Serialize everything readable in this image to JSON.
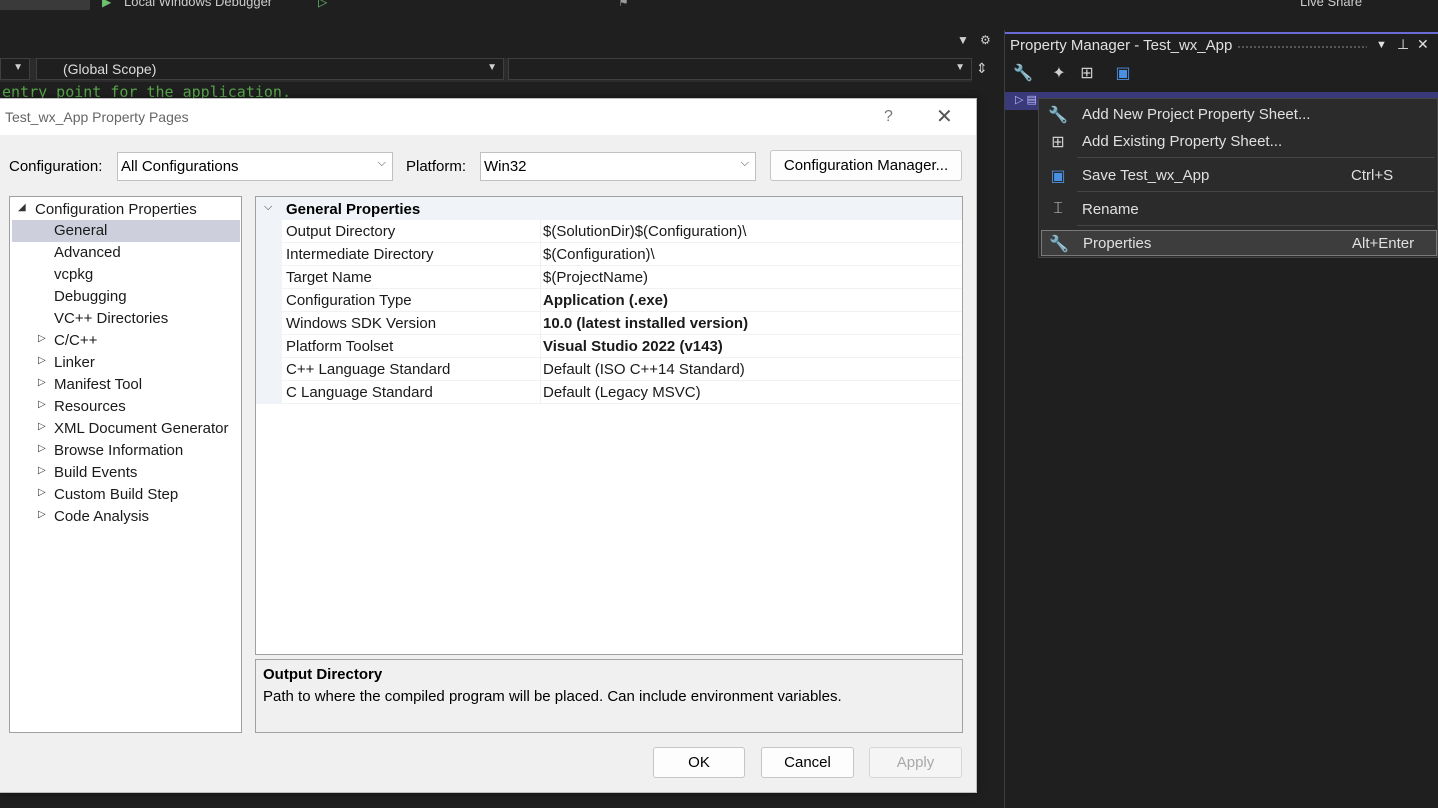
{
  "toolbar": {
    "run_label": "Local Windows Debugger",
    "live_share": "Live Share"
  },
  "editor": {
    "scope": "(Global Scope)",
    "code_line": "entry point for the application."
  },
  "property_manager": {
    "title": "Property Manager - Test_wx_App",
    "icons": [
      "wrench-icon",
      "wand-icon",
      "add-sheet-icon",
      "save-icon"
    ]
  },
  "context_menu": {
    "items": [
      {
        "label": "Add New Project Property Sheet...",
        "shortcut": "",
        "icon": "wrench-icon"
      },
      {
        "label": "Add Existing Property Sheet...",
        "shortcut": "",
        "icon": "add-sheet-icon"
      },
      {
        "label": "Save Test_wx_App",
        "shortcut": "Ctrl+S",
        "icon": "save-icon"
      },
      {
        "label": "Rename",
        "shortcut": "",
        "icon": "rename-icon"
      },
      {
        "label": "Properties",
        "shortcut": "Alt+Enter",
        "icon": "wrench-icon"
      }
    ]
  },
  "dialog": {
    "title": "Test_wx_App Property Pages",
    "help": "?",
    "configuration_label": "Configuration:",
    "configuration_value": "All Configurations",
    "platform_label": "Platform:",
    "platform_value": "Win32",
    "config_manager_button": "Configuration Manager...",
    "tree": {
      "root": "Configuration Properties",
      "items": [
        {
          "label": "General",
          "expandable": false,
          "selected": true
        },
        {
          "label": "Advanced",
          "expandable": false
        },
        {
          "label": "vcpkg",
          "expandable": false
        },
        {
          "label": "Debugging",
          "expandable": false
        },
        {
          "label": "VC++ Directories",
          "expandable": false
        },
        {
          "label": "C/C++",
          "expandable": true
        },
        {
          "label": "Linker",
          "expandable": true
        },
        {
          "label": "Manifest Tool",
          "expandable": true
        },
        {
          "label": "Resources",
          "expandable": true
        },
        {
          "label": "XML Document Generator",
          "expandable": true
        },
        {
          "label": "Browse Information",
          "expandable": true
        },
        {
          "label": "Build Events",
          "expandable": true
        },
        {
          "label": "Custom Build Step",
          "expandable": true
        },
        {
          "label": "Code Analysis",
          "expandable": true
        }
      ]
    },
    "grid": {
      "category": "General Properties",
      "rows": [
        {
          "name": "Output Directory",
          "value": "$(SolutionDir)$(Configuration)\\",
          "bold": false
        },
        {
          "name": "Intermediate Directory",
          "value": "$(Configuration)\\",
          "bold": false
        },
        {
          "name": "Target Name",
          "value": "$(ProjectName)",
          "bold": false
        },
        {
          "name": "Configuration Type",
          "value": "Application (.exe)",
          "bold": true
        },
        {
          "name": "Windows SDK Version",
          "value": "10.0 (latest installed version)",
          "bold": true
        },
        {
          "name": "Platform Toolset",
          "value": "Visual Studio 2022 (v143)",
          "bold": true
        },
        {
          "name": "C++ Language Standard",
          "value": "Default (ISO C++14 Standard)",
          "bold": false
        },
        {
          "name": "C Language Standard",
          "value": "Default (Legacy MSVC)",
          "bold": false
        }
      ]
    },
    "description": {
      "title": "Output Directory",
      "text": "Path to where the compiled program will be placed. Can include environment variables."
    },
    "buttons": {
      "ok": "OK",
      "cancel": "Cancel",
      "apply": "Apply"
    }
  },
  "colors": {
    "accent": "#6b6bd6",
    "selection": "#cdd0dc",
    "code_comment": "#57a64a"
  }
}
